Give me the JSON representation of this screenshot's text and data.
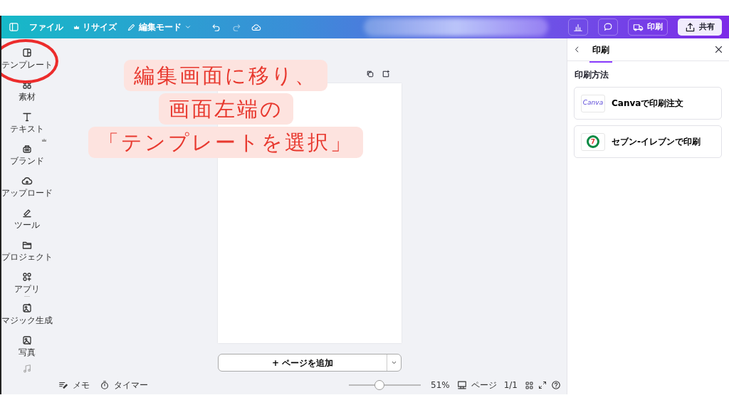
{
  "top_bar": {
    "menu": [
      {
        "label": "ファイル",
        "premium": false
      },
      {
        "label": "リサイズ",
        "premium": true
      }
    ],
    "edit_mode": "編集モード",
    "print_button": "印刷",
    "share_button": "共有"
  },
  "sidebar": {
    "items": [
      {
        "label": "テンプレート",
        "premium": false
      },
      {
        "label": "素材",
        "premium": false
      },
      {
        "label": "テキスト",
        "premium": false
      },
      {
        "label": "ブランド",
        "premium": true
      },
      {
        "label": "アップロード",
        "premium": false
      },
      {
        "label": "ツール",
        "premium": false
      },
      {
        "label": "プロジェクト",
        "premium": false
      },
      {
        "label": "アプリ",
        "premium": false
      },
      {
        "label": "マジック生成",
        "premium": false
      },
      {
        "label": "写真",
        "premium": false
      }
    ]
  },
  "canvas": {
    "add_page_button": "+ ページを追加"
  },
  "bottom_bar": {
    "notes": "メモ",
    "timer": "タイマー",
    "zoom": {
      "level": 0.43
    },
    "zoom_reading": "51%",
    "pages_label": "ページ",
    "page_count": "1/1"
  },
  "print_panel": {
    "tab": "印刷",
    "section_title": "印刷方法",
    "options": [
      {
        "kind": "canva",
        "logo": "Canva",
        "label": "Canvaで印刷注文"
      },
      {
        "kind": "seven",
        "logo": "7",
        "label": "セブン-イレブンで印刷"
      }
    ]
  },
  "annotation": {
    "lines": [
      "編集画面に移り、",
      "画面左端の",
      "「テンプレートを選択」"
    ]
  }
}
